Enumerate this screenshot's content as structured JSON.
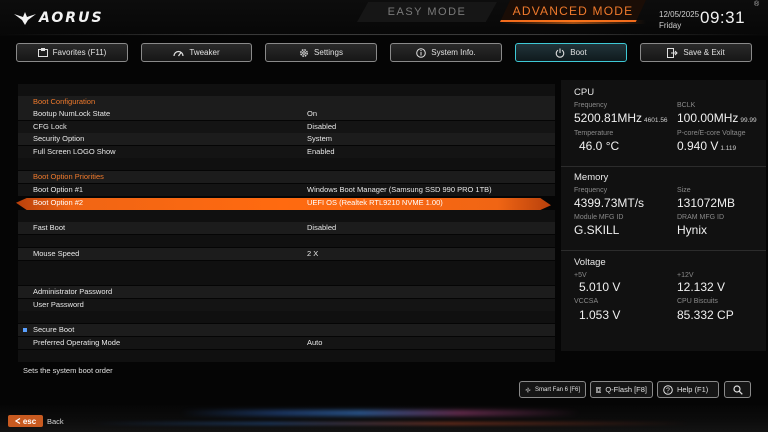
{
  "header": {
    "brand": "AORUS",
    "easy_mode": "EASY MODE",
    "advanced_mode": "ADVANCED MODE",
    "date": "12/05/2025",
    "weekday": "Friday",
    "time": "09:31",
    "registered": "®"
  },
  "tabs": [
    {
      "label": "Favorites (F11)",
      "icon": "favorites-icon"
    },
    {
      "label": "Tweaker",
      "icon": "gauge-icon"
    },
    {
      "label": "Settings",
      "icon": "gear-icon"
    },
    {
      "label": "System Info.",
      "icon": "info-icon"
    },
    {
      "label": "Boot",
      "icon": "power-icon",
      "active": true
    },
    {
      "label": "Save & Exit",
      "icon": "exit-icon"
    }
  ],
  "settings": {
    "boot_configuration": "Boot Configuration",
    "numlock": {
      "label": "Bootup NumLock State",
      "value": "On"
    },
    "cfg_lock": {
      "label": "CFG Lock",
      "value": "Disabled"
    },
    "security": {
      "label": "Security Option",
      "value": "System"
    },
    "logo": {
      "label": "Full Screen LOGO Show",
      "value": "Enabled"
    },
    "priorities": "Boot Option Priorities",
    "boot1": {
      "label": "Boot Option #1",
      "value": "Windows Boot Manager (Samsung SSD 990 PRO 1TB)"
    },
    "boot2": {
      "label": "Boot Option #2",
      "value": "UEFI OS (Realtek RTL9210 NVME 1.00)"
    },
    "fast_boot": {
      "label": "Fast Boot",
      "value": "Disabled"
    },
    "mouse_speed": {
      "label": "Mouse Speed",
      "value": "2 X"
    },
    "admin_password": {
      "label": "Administrator Password"
    },
    "user_password": {
      "label": "User Password"
    },
    "secure_boot": {
      "label": "Secure Boot"
    },
    "os_mode": {
      "label": "Preferred Operating Mode",
      "value": "Auto"
    }
  },
  "help_text": "Sets the system boot order",
  "info": {
    "cpu": {
      "title": "CPU",
      "frequency_label": "Frequency",
      "frequency": "5200.81MHz",
      "frequency_sub": "4601.56",
      "bclk_label": "BCLK",
      "bclk": "100.00MHz",
      "bclk_sub": "99.99",
      "temp_label": "Temperature",
      "temp": "46.0 °C",
      "voltage_label": "P-core/E-core Voltage",
      "voltage": "0.940 V",
      "voltage_sub": "1.119"
    },
    "memory": {
      "title": "Memory",
      "frequency_label": "Frequency",
      "frequency": "4399.73MT/s",
      "size_label": "Size",
      "size": "131072MB",
      "module_label": "Module MFG ID",
      "module": "G.SKILL",
      "dram_label": "DRAM MFG ID",
      "dram": "Hynix"
    },
    "voltage": {
      "title": "Voltage",
      "v5_label": "+5V",
      "v5": "5.010 V",
      "v12_label": "+12V",
      "v12": "12.132 V",
      "vccsa_label": "VCCSA",
      "vccsa": "1.053 V",
      "biscuits_label": "CPU Biscuits",
      "biscuits": "85.332 CP"
    }
  },
  "bottom": {
    "smart_fan": "Smart Fan 6 [F6]",
    "qflash": "Q-Flash [F8]",
    "help": "Help (F1)",
    "esc": "esc",
    "back": "Back"
  },
  "colors": {
    "accent": "#f06a1c",
    "active_tab": "#3ec9d6"
  }
}
